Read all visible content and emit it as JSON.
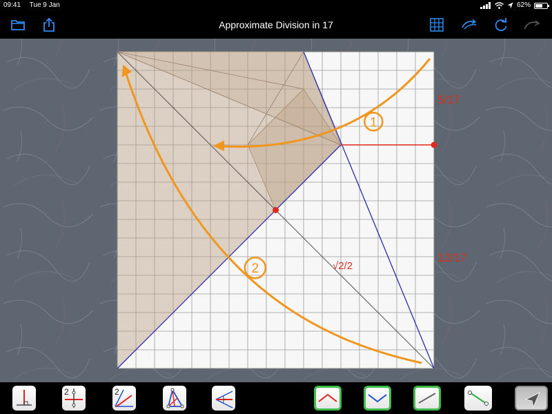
{
  "status": {
    "time": "09:41",
    "date": "Tue 9 Jan",
    "battery": "62%",
    "battery_level": 0.62
  },
  "nav": {
    "title": "Approximate Division in 17",
    "left_icons": [
      "folder-icon",
      "share-icon"
    ],
    "right_icons": [
      "grid-icon",
      "undo-swoop-icon",
      "redo-icon",
      "redo-disabled-icon"
    ]
  },
  "diagram": {
    "label_top_right": "5/17",
    "label_bottom_right": "12/17",
    "label_diagonal": "√2/2",
    "step_1": "1",
    "step_2": "2",
    "grid_divisions": 17,
    "colors": {
      "paper": "#f7f7f7",
      "shade": "#b89a7e",
      "orange": "#f0961e",
      "blue": "#2a2aa8",
      "red": "#dd2a1e",
      "label_red": "#d8321e"
    }
  },
  "toolbar": {
    "tools": [
      "perpendicular-tool-icon",
      "midpoint-tool-icon",
      "bisect-tool-icon",
      "triangle-tool-icon",
      "angle-tool-icon",
      "valley-fold-icon",
      "mountain-fold-icon",
      "crease-icon",
      "segment-icon",
      "cursor-icon"
    ]
  }
}
